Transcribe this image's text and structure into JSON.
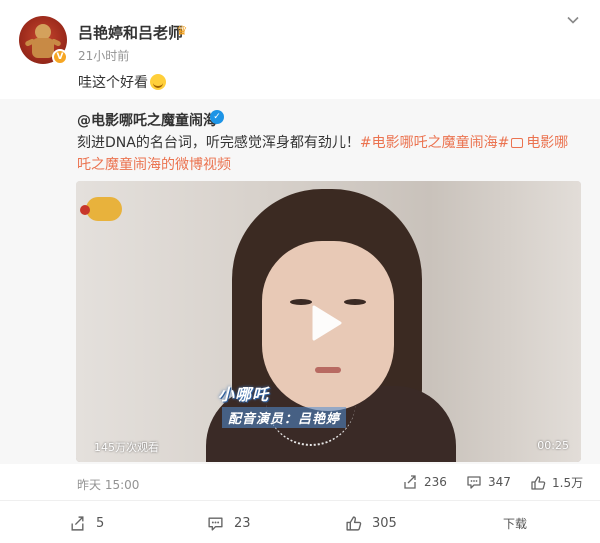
{
  "post": {
    "username": "吕艳婷和吕老师",
    "time": "21小时前",
    "text": "哇这个好看",
    "verified_badge": "V"
  },
  "repost": {
    "author": "@电影哪吒之魔童闹海",
    "text_prefix": "刻进DNA的名台词，听完感觉浑身都有劲儿！",
    "hashtag": "#电影哪吒之魔童闹海#",
    "video_link": "电影哪吒之魔童闹海的微博视频",
    "video": {
      "caption_name": "小哪吒",
      "caption_role": "配音演员：吕艳婷",
      "views": "145万次观看",
      "duration": "00:25"
    },
    "time": "昨天 15:00",
    "stats": {
      "shares": "236",
      "comments": "347",
      "likes": "1.5万"
    }
  },
  "actions": {
    "shares": "5",
    "comments": "23",
    "likes": "305",
    "download": "下载"
  },
  "colors": {
    "accent": "#eb7350",
    "verified": "#1d94e6"
  }
}
